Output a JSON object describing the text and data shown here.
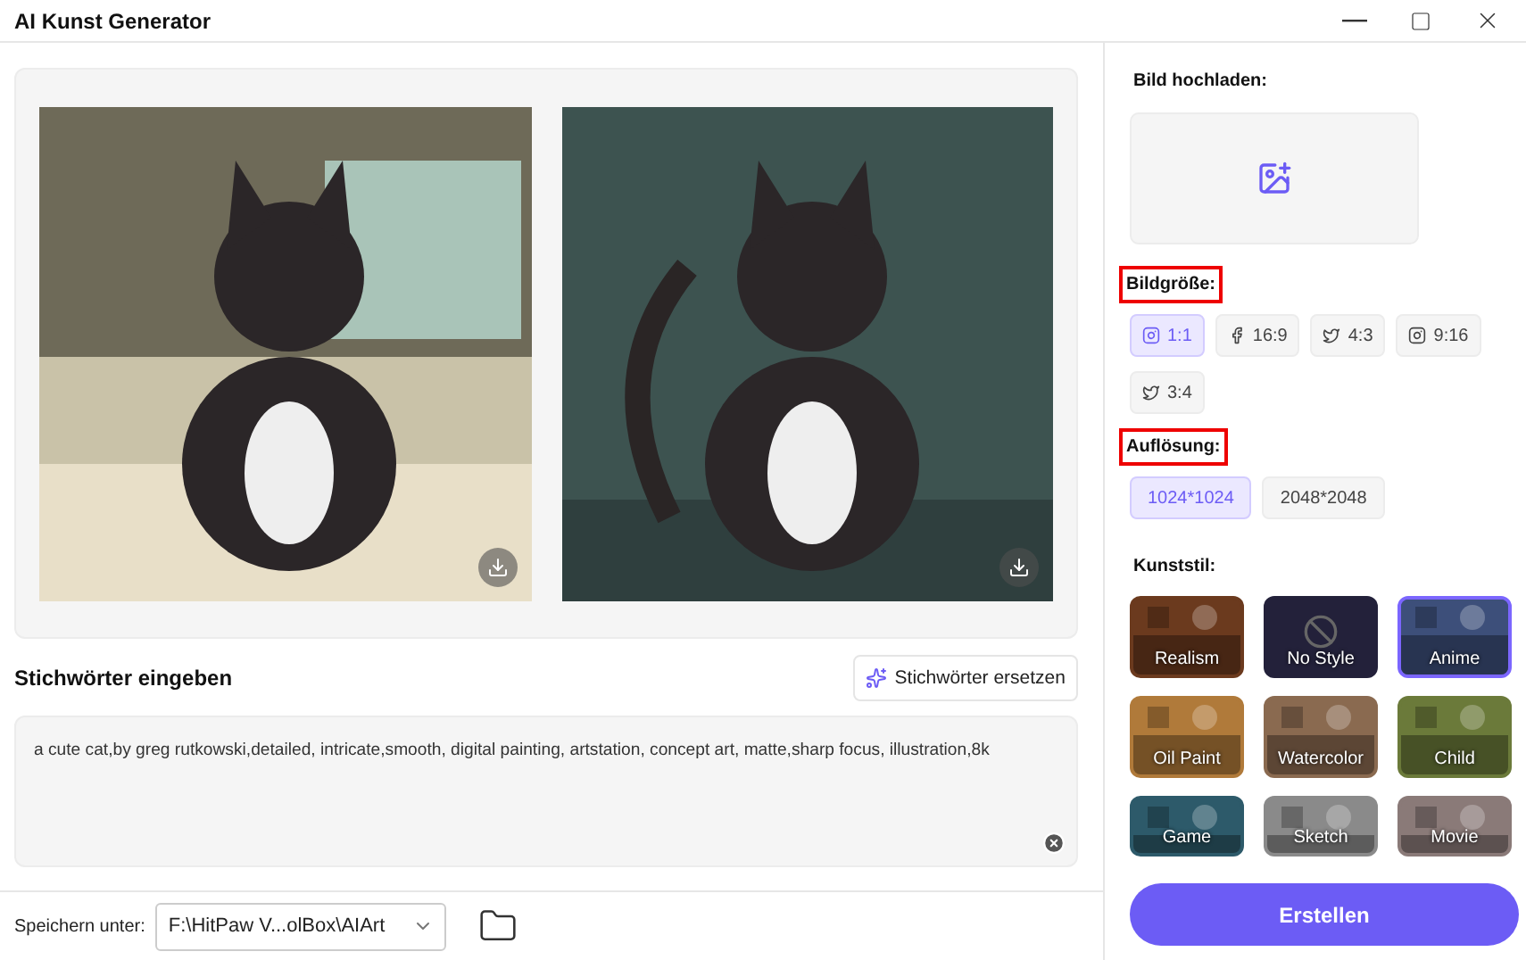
{
  "window": {
    "title": "AI Kunst Generator"
  },
  "prompt": {
    "title": "Stichwörter eingeben",
    "replace_button": "Stichwörter ersetzen",
    "value": "a cute cat,by greg rutkowski,detailed, intricate,smooth, digital painting, artstation, concept art, matte,sharp focus, illustration,8k"
  },
  "save": {
    "label": "Speichern unter:",
    "path": "F:\\HitPaw V...olBox\\AIArt"
  },
  "upload": {
    "title": "Bild hochladen:"
  },
  "size": {
    "title": "Bildgröße:",
    "highlighted": true,
    "options": [
      {
        "label": "1:1",
        "kind": "instagram",
        "selected": true
      },
      {
        "label": "16:9",
        "kind": "facebook",
        "selected": false
      },
      {
        "label": "4:3",
        "kind": "twitter",
        "selected": false
      },
      {
        "label": "9:16",
        "kind": "instagram",
        "selected": false
      },
      {
        "label": "3:4",
        "kind": "twitter",
        "selected": false
      }
    ]
  },
  "resolution": {
    "title": "Auflösung:",
    "highlighted": true,
    "options": [
      {
        "label": "1024*1024",
        "selected": true
      },
      {
        "label": "2048*2048",
        "selected": false
      }
    ]
  },
  "style": {
    "title": "Kunststil:",
    "items": [
      {
        "label": "Realism",
        "kind": "picture",
        "selected": false,
        "color": "#6b3a1e"
      },
      {
        "label": "No Style",
        "kind": "none",
        "selected": false,
        "color": "#23213a"
      },
      {
        "label": "Anime",
        "kind": "picture",
        "selected": true,
        "color": "#3d4f7a"
      },
      {
        "label": "Oil Paint",
        "kind": "picture",
        "selected": false,
        "color": "#b07a3a"
      },
      {
        "label": "Watercolor",
        "kind": "picture",
        "selected": false,
        "color": "#8a6a50"
      },
      {
        "label": "Child",
        "kind": "picture",
        "selected": false,
        "color": "#6b7a3a"
      },
      {
        "label": "Game",
        "kind": "picture",
        "selected": false,
        "color": "#2d5a6a"
      },
      {
        "label": "Sketch",
        "kind": "picture",
        "selected": false,
        "color": "#8a8a8a"
      },
      {
        "label": "Movie",
        "kind": "picture",
        "selected": false,
        "color": "#8a7a78"
      }
    ]
  },
  "create_button": "Erstellen"
}
